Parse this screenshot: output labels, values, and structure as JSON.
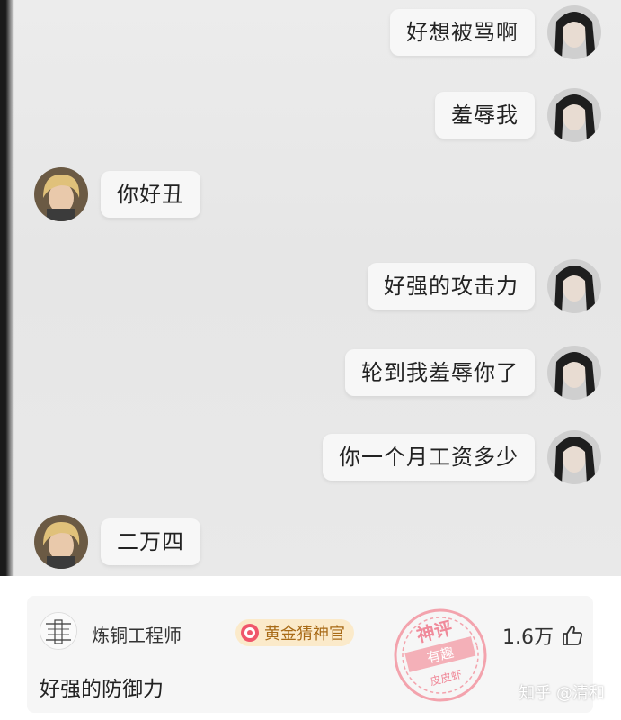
{
  "chat": {
    "messages": [
      {
        "side": "right",
        "text": "好想被骂啊"
      },
      {
        "side": "right",
        "text": "羞辱我"
      },
      {
        "side": "left",
        "text": "你好丑"
      },
      {
        "side": "right",
        "text": "好强的攻击力"
      },
      {
        "side": "right",
        "text": "轮到我羞辱你了"
      },
      {
        "side": "right",
        "text": "你一个月工资多少"
      },
      {
        "side": "left",
        "text": "二万四"
      }
    ]
  },
  "comment": {
    "username": "炼铜工程师",
    "badge": "黄金猜神官",
    "body": "好强的防御力",
    "likes": "1.6万"
  },
  "stamp": {
    "line1": "神评",
    "line2": "有趣",
    "line3": "皮皮虾"
  },
  "watermark": "知乎 @清和",
  "colors": {
    "bubble": "#f7f7f7",
    "badge_bg": "#fbeaca",
    "badge_text": "#a86a16",
    "stamp": "#f08a9a"
  }
}
